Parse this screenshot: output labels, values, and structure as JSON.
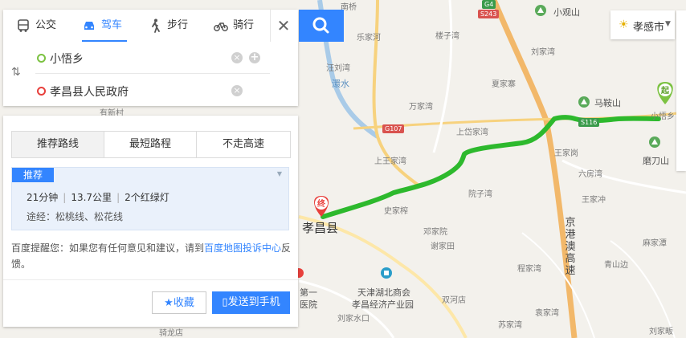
{
  "tabs": [
    {
      "label": "公交",
      "icon": "bus-icon"
    },
    {
      "label": "驾车",
      "icon": "car-icon"
    },
    {
      "label": "步行",
      "icon": "walk-icon"
    },
    {
      "label": "骑行",
      "icon": "bike-icon"
    }
  ],
  "active_tab": "驾车",
  "start": {
    "value": "小悟乡"
  },
  "end": {
    "value": "孝昌县人民政府"
  },
  "city": {
    "name": "孝感市"
  },
  "options": [
    "推荐路线",
    "最短路程",
    "不走高速"
  ],
  "plan": {
    "badge": "推荐",
    "time": "21分钟",
    "distance": "13.7公里",
    "lights": "2个红绿灯",
    "via": "途经：松桃线、松花线"
  },
  "tip": {
    "before": "百度提醒您：如果您有任何意见和建议，请到",
    "link": "百度地图投诉中心",
    "after": "反馈。"
  },
  "buttons": {
    "favorite": "收藏",
    "send": "发送到手机"
  },
  "markers": {
    "start": "起",
    "end": "终"
  },
  "colors": {
    "accent": "#3385ff",
    "route": "#2db92d",
    "start": "#7cc242",
    "end": "#e8403c"
  },
  "map": {
    "places_major": [
      "孝昌县",
      "马鞍山",
      "磨刀山",
      "小观山"
    ],
    "places": [
      "乐家河",
      "楼子湾",
      "汪刘湾",
      "夏家寨",
      "万家湾",
      "上王家湾",
      "上岱家湾",
      "王家岗",
      "六房湾",
      "王家冲",
      "院子湾",
      "史家榨",
      "邓家院",
      "谢家田",
      "刘家湾",
      "程家湾",
      "双河店",
      "麻家潭",
      "青山边",
      "刘家畈",
      "袁家湾",
      "苏家湾",
      "刘家水口",
      "骑龙店",
      "有新村",
      "南桥",
      "小悟乡",
      "天津湖北商会",
      "孝昌经济产业园",
      "第一",
      "医院",
      "澴水"
    ],
    "roads": [
      "G107",
      "S116",
      "S243",
      "G4"
    ],
    "highway": "京港澳高速"
  }
}
